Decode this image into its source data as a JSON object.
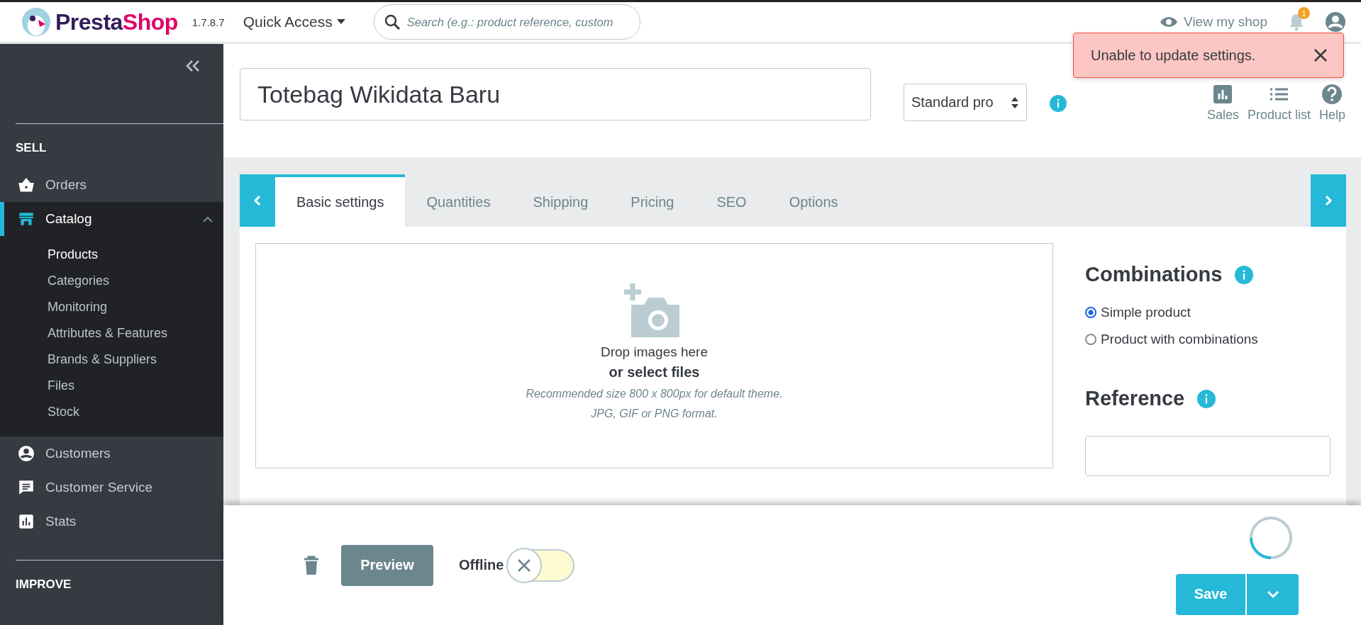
{
  "header": {
    "logo": "PrestaShop",
    "version": "1.7.8.7",
    "quick_access": "Quick Access",
    "search": {
      "placeholder": "Search (e.g.: product reference, custom"
    },
    "view_shop": "View my shop",
    "notifications_badge": "1"
  },
  "toast": {
    "message": "Unable to update settings."
  },
  "sidebar": {
    "sections": [
      {
        "title": "SELL",
        "items": [
          {
            "label": "Orders",
            "selected": false
          },
          {
            "label": "Catalog",
            "selected": true,
            "expanded": true,
            "children": [
              {
                "label": "Products",
                "selected": true
              },
              {
                "label": "Categories",
                "selected": false
              },
              {
                "label": "Monitoring",
                "selected": false
              },
              {
                "label": "Attributes & Features",
                "selected": false
              },
              {
                "label": "Brands & Suppliers",
                "selected": false
              },
              {
                "label": "Files",
                "selected": false
              },
              {
                "label": "Stock",
                "selected": false
              }
            ]
          },
          {
            "label": "Customers",
            "selected": false
          },
          {
            "label": "Customer Service",
            "selected": false
          },
          {
            "label": "Stats",
            "selected": false
          }
        ]
      },
      {
        "title": "IMPROVE"
      }
    ]
  },
  "product": {
    "name": "Totebag Wikidata Baru",
    "type": "Standard pro"
  },
  "quick_links": [
    {
      "label": "Sales"
    },
    {
      "label": "Product list"
    },
    {
      "label": "Help"
    }
  ],
  "tabs": [
    {
      "label": "Basic settings",
      "selected": true
    },
    {
      "label": "Quantities",
      "selected": false
    },
    {
      "label": "Shipping",
      "selected": false
    },
    {
      "label": "Pricing",
      "selected": false
    },
    {
      "label": "SEO",
      "selected": false
    },
    {
      "label": "Options",
      "selected": false
    }
  ],
  "dropzone": {
    "title": "Drop images here",
    "link": "or select files",
    "hint_1": "Recommended size 800 x 800px for default theme.",
    "hint_2": "JPG, GIF or PNG format."
  },
  "combinations": {
    "title": "Combinations",
    "options": [
      {
        "label": "Simple product",
        "selected": true
      },
      {
        "label": "Product with combinations",
        "selected": false
      }
    ]
  },
  "reference": {
    "title": "Reference"
  },
  "footer": {
    "preview": "Preview",
    "status_label": "Offline",
    "online": false,
    "save": "Save"
  }
}
